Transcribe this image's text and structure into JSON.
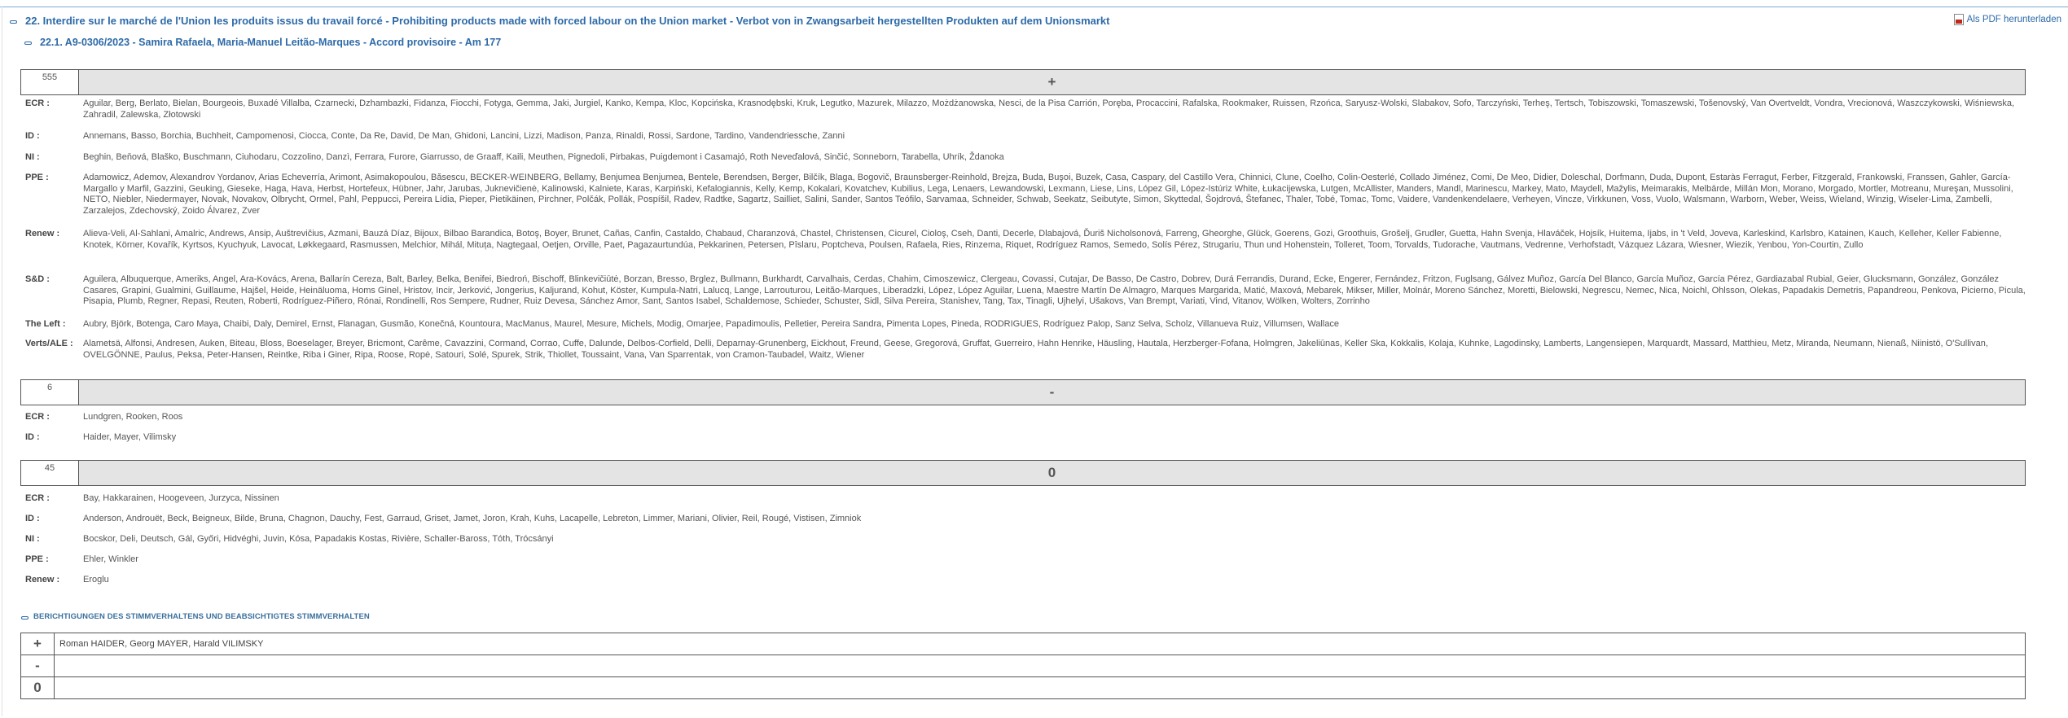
{
  "header": {
    "title": "22. Interdire sur le marché de l'Union les produits issus du travail forcé - Prohibiting products made with forced labour on the Union market - Verbot von in Zwangsarbeit hergestellten Produkten auf dem Unionsmarkt",
    "subtitle": "22.1.   A9-0306/2023 - Samira Rafaela, Maria-Manuel Leitão-Marques - Accord provisoire - Am 177",
    "pdf_label": "Als PDF herunterladen"
  },
  "votes": [
    {
      "count": "555",
      "symbol": "+",
      "groups": [
        {
          "label": "ECR :",
          "members": "Aguilar, Berg, Berlato, Bielan, Bourgeois, Buxadé Villalba, Czarnecki, Dzhambazki, Fidanza, Fiocchi, Fotyga, Gemma, Jaki, Jurgiel, Kanko, Kempa, Kloc, Kopcińska, Krasnodębski, Kruk, Legutko, Mazurek, Milazzo, Możdżanowska, Nesci, de la Pisa Carrión, Poręba, Procaccini, Rafalska, Rookmaker, Ruissen, Rzońca, Saryusz-Wolski, Slabakov, Sofo, Tarczyński, Terheş, Tertsch, Tobiszowski, Tomaszewski, Tošenovský, Van Overtveldt, Vondra, Vrecionová, Waszczykowski, Wiśniewska, Zahradil, Zalewska, Złotowski"
        },
        {
          "label": "ID :",
          "members": "Annemans, Basso, Borchia, Buchheit, Campomenosi, Ciocca, Conte, Da Re, David, De Man, Ghidoni, Lancini, Lizzi, Madison, Panza, Rinaldi, Rossi, Sardone, Tardino, Vandendriessche, Zanni"
        },
        {
          "label": "NI :",
          "members": "Beghin, Beňová, Blaško, Buschmann, Ciuhodaru, Cozzolino, Danzì, Ferrara, Furore, Giarrusso, de Graaff, Kaili, Meuthen, Pignedoli, Pirbakas, Puigdemont i Casamajó, Roth Neveďalová, Sinčić, Sonneborn, Tarabella, Uhrík, Ždanoka"
        },
        {
          "label": "PPE :",
          "members": "Adamowicz, Ademov, Alexandrov Yordanov, Arias Echeverría, Arimont, Asimakopoulou, Băsescu, BECKER-WEINBERG, Bellamy, Benjumea Benjumea, Bentele, Berendsen, Berger, Bilčík, Blaga, Bogovič, Braunsberger-Reinhold, Brejza, Buda, Buşoi, Buzek, Casa, Caspary, del Castillo Vera, Chinnici, Clune, Coelho, Colin-Oesterlé, Collado Jiménez, Comi, De Meo, Didier, Doleschal, Dorfmann, Duda, Dupont, Estaràs Ferragut, Ferber, Fitzgerald, Frankowski, Franssen, Gahler, García-Margallo y Marfil, Gazzini, Geuking, Gieseke, Haga, Hava, Herbst, Hortefeux, Hübner, Jahr, Jarubas, Juknevičienė, Kalinowski, Kalniete, Karas, Karpiński, Kefalogiannis, Kelly, Kemp, Kokalari, Kovatchev, Kubilius, Lega, Lenaers, Lewandowski, Lexmann, Liese, Lins, López Gil, López-Istúriz White, Łukacijewska, Lutgen, McAllister, Manders, Mandl, Marinescu, Markey, Mato, Maydell, Mažylis, Meimarakis, Melbārde, Millán Mon, Morano, Morgado, Mortler, Motreanu, Mureşan, Mussolini, NETO, Niebler, Niedermayer, Novak, Novakov, Olbrycht, Ormel, Pahl, Peppucci, Pereira Lídia, Pieper, Pietikäinen, Pirchner, Polčák, Pollák, Pospíšil, Radev, Radtke, Sagartz, Sailliet, Salini, Sander, Santos Teófilo, Sarvamaa, Schneider, Schwab, Seekatz, Seibutyte, Simon, Skyttedal, Šojdrová, Štefanec, Thaler, Tobé, Tomac, Tomc, Vaidere, Vandenkendelaere, Verheyen, Vincze, Virkkunen, Voss, Vuolo, Walsmann, Warborn, Weber, Weiss, Wieland, Winzig, Wiseler-Lima, Zambelli, Zarzalejos, Zdechovský, Zoido Álvarez, Zver"
        },
        {
          "label": "Renew :",
          "members": "Alieva-Veli, Al-Sahlani, Amalric, Andrews, Ansip, Auštrevičius, Azmani, Bauzá Díaz, Bijoux, Bilbao Barandica, Botoş, Boyer, Brunet, Cañas, Canfin, Castaldo, Chabaud, Charanzová, Chastel, Christensen, Cicurel, Cioloş, Cseh, Danti, Decerle, Dlabajová, Ďuriš Nicholsonová, Farreng, Gheorghe, Glück, Goerens, Gozi, Groothuis, Grošelj, Grudler, Guetta, Hahn Svenja, Hlaváček, Hojsík, Huitema, Ijabs, in 't Veld, Joveva, Karleskind, Karlsbro, Katainen, Kauch, Kelleher, Keller Fabienne, Knotek, Körner, Kovařík, Kyrtsos, Kyuchyuk, Lavocat, Løkkegaard, Rasmussen, Melchior, Mihál, Mituța, Nagtegaal, Oetjen, Orville, Paet, Pagazaurtundúa, Pekkarinen, Petersen, Pîslaru, Poptcheva, Poulsen, Rafaela, Ries, Rinzema, Riquet, Rodríguez Ramos, Semedo, Solís Pérez, Strugariu, Thun und Hohenstein, Tolleret, Toom, Torvalds, Tudorache, Vautmans, Vedrenne, Verhofstadt, Vázquez Lázara, Wiesner, Wiezik, Yenbou, Yon-Courtin, Zullo"
        },
        {
          "label": "S&D :",
          "members": "Aguilera, Albuquerque, Ameriks, Angel, Ara-Kovács, Arena, Ballarín Cereza, Balt, Barley, Belka, Benifei, Biedroń, Bischoff, Blinkevičiūtė, Borzan, Bresso, Brglez, Bullmann, Burkhardt, Carvalhais, Cerdas, Chahim, Cimoszewicz, Clergeau, Covassi, Cutajar, De Basso, De Castro, Dobrev, Durá Ferrandis, Durand, Ecke, Engerer, Fernández, Fritzon, Fuglsang, Gálvez Muñoz, García Del Blanco, García Muñoz, García Pérez, Gardiazabal Rubial, Geier, Glucksmann, González, González Casares, Grapini, Gualmini, Guillaume, Hajšel, Heide, Heinäluoma, Homs Ginel, Hristov, Incir, Jerković, Jongerius, Kaljurand, Kohut, Köster, Kumpula-Natri, Lalucq, Lange, Larrouturou, Leitão-Marques, Liberadzki, López, López Aguilar, Luena, Maestre Martín De Almagro, Marques Margarida, Matić, Maxová, Mebarek, Mikser, Miller, Molnár, Moreno Sánchez, Moretti, Bielowski, Negrescu, Nemec, Nica, Noichl, Ohlsson, Olekas, Papadakis Demetris, Papandreou, Penkova, Picierno, Picula, Pisapia, Plumb, Regner, Repasi, Reuten, Roberti, Rodríguez-Piñero, Rónai, Rondinelli, Ros Sempere, Rudner, Ruiz Devesa, Sánchez Amor, Sant, Santos Isabel, Schaldemose, Schieder, Schuster, Sidl, Silva Pereira, Stanishev, Tang, Tax, Tinagli, Ujhelyi, Ušakovs, Van Brempt, Variati, Vind, Vitanov, Wölken, Wolters, Zorrinho"
        },
        {
          "label": "The Left :",
          "members": "Aubry, Björk, Botenga, Caro Maya, Chaibi, Daly, Demirel, Ernst, Flanagan, Gusmão, Konečná, Kountoura, MacManus, Maurel, Mesure, Michels, Modig, Omarjee, Papadimoulis, Pelletier, Pereira Sandra, Pimenta Lopes, Pineda, RODRIGUES, Rodríguez Palop, Sanz Selva, Scholz, Villanueva Ruiz, Villumsen, Wallace"
        },
        {
          "label": "Verts/ALE :",
          "members": "Alametsä, Alfonsi, Andresen, Auken, Biteau, Bloss, Boeselager, Breyer, Bricmont, Carême, Cavazzini, Cormand, Corrao, Cuffe, Dalunde, Delbos-Corfield, Delli, Deparnay-Grunenberg, Eickhout, Freund, Geese, Gregorová, Gruffat, Guerreiro, Hahn Henrike, Häusling, Hautala, Herzberger-Fofana, Holmgren, Jakeliūnas, Keller Ska, Kokkalis, Kolaja, Kuhnke, Lagodinsky, Lamberts, Langensiepen, Marquardt, Massard, Matthieu, Metz, Miranda, Neumann, Nienaß, Niinistö, O'Sullivan, OVELGÖNNE, Paulus, Peksa, Peter-Hansen, Reintke, Riba i Giner, Ripa, Roose, Ropė, Satouri, Solé, Spurek, Strik, Thiollet, Toussaint, Vana, Van Sparrentak, von Cramon-Taubadel, Waitz, Wiener"
        }
      ]
    },
    {
      "count": "6",
      "symbol": "-",
      "groups": [
        {
          "label": "ECR :",
          "members": "Lundgren, Rooken, Roos"
        },
        {
          "label": "ID :",
          "members": "Haider, Mayer, Vilimsky"
        }
      ]
    },
    {
      "count": "45",
      "symbol": "0",
      "groups": [
        {
          "label": "ECR :",
          "members": "Bay, Hakkarainen, Hoogeveen, Jurzyca, Nissinen"
        },
        {
          "label": "ID :",
          "members": "Anderson, Androuët, Beck, Beigneux, Bilde, Bruna, Chagnon, Dauchy, Fest, Garraud, Griset, Jamet, Joron, Krah, Kuhs, Lacapelle, Lebreton, Limmer, Mariani, Olivier, Reil, Rougé, Vistisen, Zimniok"
        },
        {
          "label": "NI :",
          "members": "Bocskor, Deli, Deutsch, Gál, Győri, Hidvéghi, Juvin, Kósa, Papadakis Kostas, Rivière, Schaller-Baross, Tóth, Trócsányi"
        },
        {
          "label": "PPE :",
          "members": "Ehler, Winkler"
        },
        {
          "label": "Renew :",
          "members": "Eroglu"
        }
      ]
    }
  ],
  "corrections": {
    "heading": "BERICHTIGUNGEN DES STIMMVERHALTENS UND BEABSICHTIGTES STIMMVERHALTEN",
    "rows": [
      {
        "symbol": "+",
        "names": "Roman HAIDER, Georg MAYER, Harald VILIMSKY"
      },
      {
        "symbol": "-",
        "names": ""
      },
      {
        "symbol": "0",
        "names": ""
      }
    ]
  }
}
